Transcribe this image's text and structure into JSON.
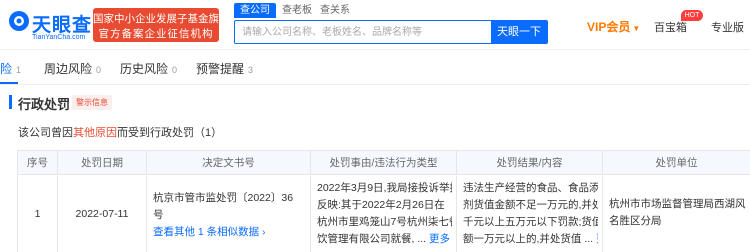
{
  "header": {
    "logo_name": "天眼查",
    "logo_domain": "TianYanCha.com",
    "cert_line1": "国家中小企业发展子基金旗下",
    "cert_line2": "官方备案企业征信机构",
    "search_tabs": [
      "查公司",
      "查老板",
      "查关系"
    ],
    "search_placeholder": "请输入公司名称、老板姓名、品牌名称等",
    "search_button": "天眼一下",
    "vip_label": "VIP会员",
    "toolbox_label": "百宝箱",
    "hot_badge": "HOT",
    "pro_label": "专业版",
    "brand_color": "#0a6cff",
    "accent_color": "#e84b31"
  },
  "risk_tabs": [
    {
      "label": "险",
      "count": "1"
    },
    {
      "label": "周边风险",
      "count": "0"
    },
    {
      "label": "历史风险",
      "count": "0"
    },
    {
      "label": "预警提醒",
      "count": "3"
    }
  ],
  "section": {
    "title": "行政处罚",
    "tag": "警示信息"
  },
  "summary": {
    "prefix": "该公司曾因",
    "highlight": "其他原因",
    "suffix": "而受到行政处罚（1）"
  },
  "table": {
    "columns": [
      "序号",
      "处罚日期",
      "决定文书号",
      "处罚事由/违法行为类型",
      "处罚结果/内容",
      "处罚单位"
    ],
    "rows": [
      {
        "index": "1",
        "date": "2022-07-11",
        "doc_no_lines": [
          "杭京市管市监处罚〔2022〕36",
          "号"
        ],
        "doc_link": "查看其他 1 条相似数据",
        "reason_lines": [
          "2022年3月9日,我局接投诉举报人",
          "反映:其于2022年2月26日在",
          "杭州市里鸡笼山7号杭州柒七餐",
          "饮管理有限公司就餐,"
        ],
        "reason_more": "更多",
        "result_lines": [
          "违法生产经营的食品、食品添加",
          "剂货值金额不足一万元的,并处五",
          "千元以上五万元以下罚款;货值金",
          "额一万元以上的,并处货值"
        ],
        "result_more": "更多",
        "authority_lines": [
          "杭州市市场监督管理局西湖风景",
          "名胜区分局"
        ]
      }
    ]
  }
}
